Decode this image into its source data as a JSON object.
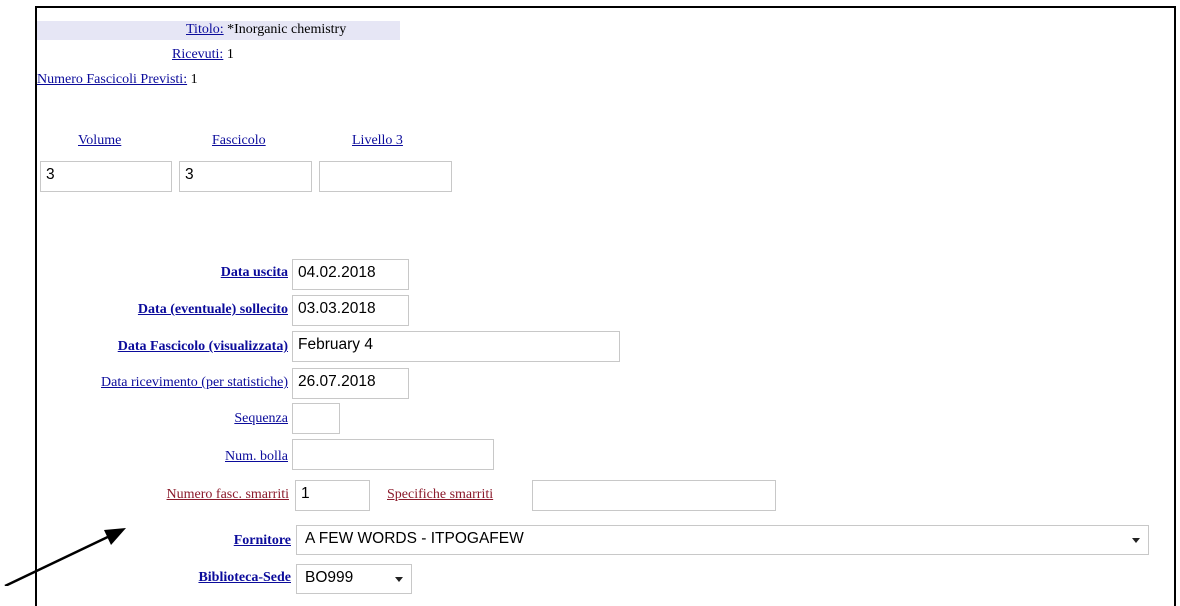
{
  "header": {
    "title_label": "Titolo:",
    "title_value": "*Inorganic chemistry",
    "received_label": "Ricevuti:",
    "received_value": "1",
    "expected_label": "Numero Fascicoli Previsti:",
    "expected_value": "1"
  },
  "issue": {
    "volume_label": "Volume",
    "volume_value": "3",
    "fascicolo_label": "Fascicolo",
    "fascicolo_value": "3",
    "livello_label": "Livello 3",
    "livello_value": ""
  },
  "form": {
    "data_uscita_label": "Data uscita",
    "data_uscita_value": "04.02.2018",
    "data_sollecito_label": "Data (eventuale) sollecito",
    "data_sollecito_value": "03.03.2018",
    "data_fascicolo_label": "Data Fascicolo (visualizzata)",
    "data_fascicolo_value": "February 4",
    "data_ricevimento_label": "Data ricevimento (per statistiche)",
    "data_ricevimento_value": "26.07.2018",
    "sequenza_label": "Sequenza",
    "sequenza_value": "",
    "num_bolla_label": "Num. bolla",
    "num_bolla_value": "",
    "smarriti_label": "Numero fasc. smarriti",
    "smarriti_value": "1",
    "specifiche_label": "Specifiche smarriti",
    "specifiche_value": "",
    "fornitore_label": "Fornitore",
    "fornitore_value": "A FEW WORDS - ITPOGAFEW",
    "biblioteca_label": "Biblioteca-Sede",
    "biblioteca_value": "BO999"
  },
  "colors": {
    "link": "#0b0b9b",
    "link_red": "#8b1a2b",
    "title_band": "#e6e6f5"
  }
}
